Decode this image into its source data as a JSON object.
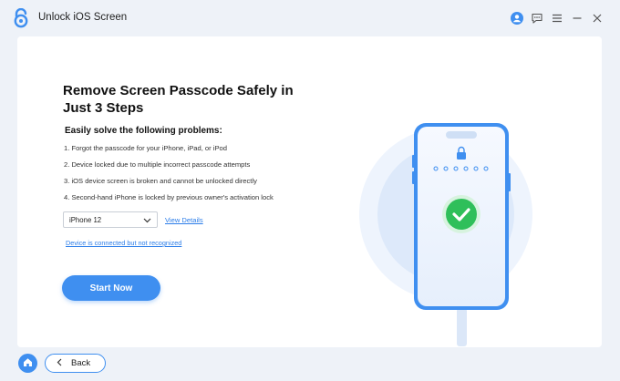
{
  "titlebar": {
    "title": "Unlock iOS Screen",
    "icons": [
      "lock-logo-icon",
      "account-icon",
      "feedback-icon",
      "menu-icon",
      "minimize-icon",
      "close-icon"
    ]
  },
  "main": {
    "headline": "Remove Screen Passcode Safely in Just 3 Steps",
    "subhead": "Easily solve the following problems:",
    "problems": [
      "1. Forgot the passcode for your iPhone, iPad, or iPod",
      "2. Device locked due to multiple incorrect passcode attempts",
      "3. iOS device screen is broken and cannot be unlocked directly",
      "4. Second-hand iPhone is locked by previous owner's activation lock"
    ],
    "device_select": {
      "value": "iPhone 12"
    },
    "view_details": "View Details",
    "not_recognized": "Device is connected but not recognized",
    "start_button": "Start Now"
  },
  "footer": {
    "back_label": "Back"
  },
  "colors": {
    "accent": "#3f8ff0",
    "link": "#2b7de9",
    "success": "#2fbf5a",
    "background": "#eef2f8"
  }
}
